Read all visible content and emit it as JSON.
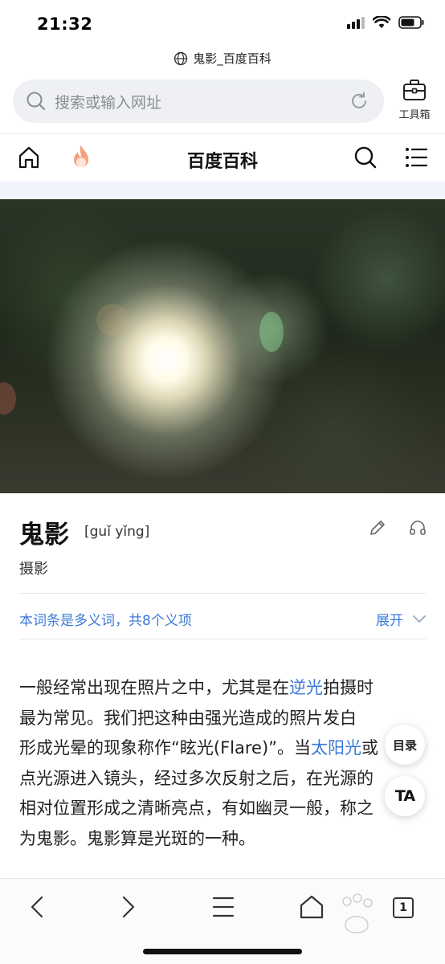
{
  "status": {
    "time": "21:32"
  },
  "browser": {
    "site_title": "鬼影_百度百科",
    "search_placeholder": "搜索或输入网址",
    "toolbox_label": "工具箱"
  },
  "nav": {
    "title": "百度百科"
  },
  "entry": {
    "title": "鬼影",
    "pinyin": "[guǐ yǐng]",
    "subtitle": "摄影",
    "polysemy_text": "本词条是多义词，共8个义项",
    "expand_label": "展开"
  },
  "paragraph": {
    "line1_a": "一般经常出现在照片之中，尤其是在",
    "line1_link": "逆光",
    "line1_b": "拍摄时",
    "line2": "最为常见。我们把这种由强光造成的照片发白",
    "line3_a": "形成光晕的现象称作“眩光(Flare)”。当",
    "line3_link": "太阳光",
    "line3_b": "或",
    "line4": "点光源进入镜头，经过多次反射之后，在光源的",
    "line5": "相对位置形成之清晰亮点，有如幽灵一般，称之",
    "line6": "为鬼影。鬼影算是光斑的一种。"
  },
  "floating": {
    "toc_label": "目录",
    "ta_label": "TA"
  },
  "bottom": {
    "tab_count": "1"
  },
  "colors": {
    "link": "#3b7ad9",
    "search_bg": "#eef0f3"
  }
}
